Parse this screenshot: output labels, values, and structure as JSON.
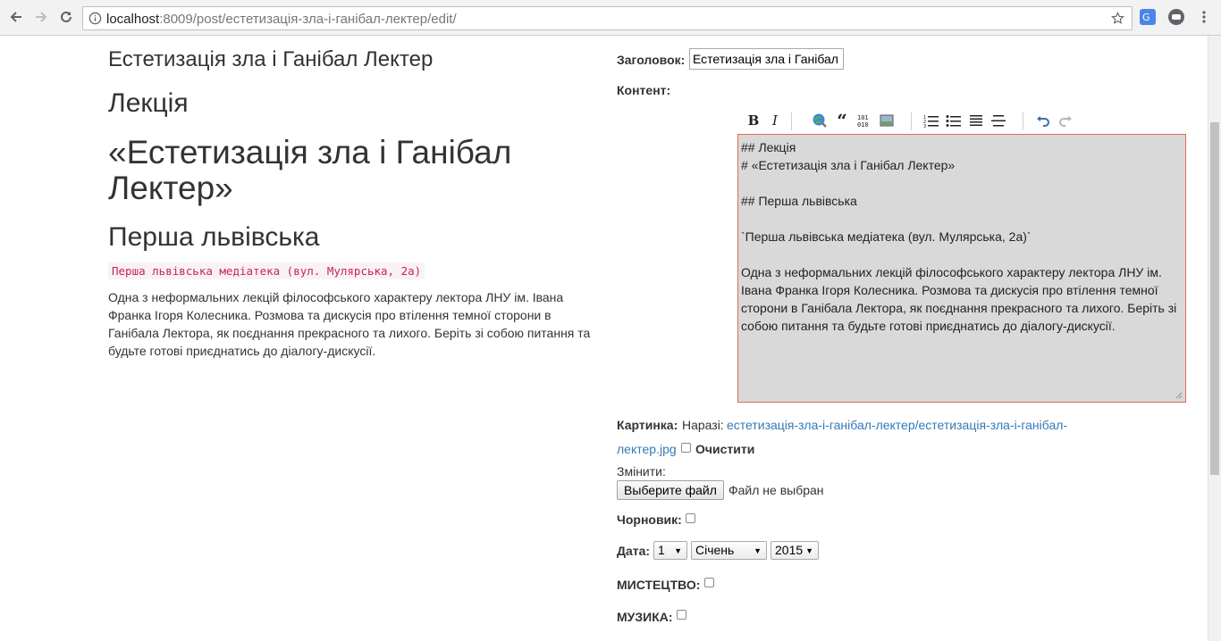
{
  "browser": {
    "url_host": "localhost",
    "url_rest": ":8009/post/естетизація-зла-і-ганібал-лектер/edit/"
  },
  "preview": {
    "title": "Естетизація зла і Ганібал Лектер",
    "h2_first": "Лекція",
    "h1": "«Естетизація зла і Ганібал Лектер»",
    "h2_second": "Перша львівська",
    "code": "Перша львівська медіатека (вул. Мулярська, 2а)",
    "paragraph": "Одна з неформальних лекцій філософського характеру лектора ЛНУ ім. Івана Франка Ігоря Колесника. Розмова та дискусія про втілення темної сторони в Ганібала Лектора, як поєднання прекрасного та лихого. Беріть зі собою питання та будьте готові приєднатись до діалогу-дискусії."
  },
  "form": {
    "title_label": "Заголовок:",
    "title_value": "Естетизація зла і Ганібал Лектер",
    "content_label": "Контент:",
    "toolbar_icons": [
      "bold-icon",
      "italic-icon",
      "link-icon",
      "quote-icon",
      "code-icon",
      "image-icon",
      "ordered-list-icon",
      "unordered-list-icon",
      "heading-icon",
      "horizontal-rule-icon",
      "undo-icon",
      "redo-icon"
    ],
    "editor_text": "## Лекція\n# «Естетизація зла і Ганібал Лектер»\n\n## Перша львівська\n\n`Перша львівська медіатека (вул. Мулярська, 2а)`\n\nОдна з неформальних лекцій філософського характеру лектора ЛНУ ім. Івана Франка Ігоря Колесника. Розмова та дискусія про втілення темної сторони в Ганібала Лектора, як поєднання прекрасного та лихого. Беріть зі собою питання та будьте готові приєднатись до діалогу-дискусії.",
    "image_label": "Картинка:",
    "image_current_prefix": "Наразі:",
    "image_link_line1": "естетизація-зла-і-ганібал-лектер/естетизація-зла-і-ганібал-",
    "image_link_line2": "лектер.jpg",
    "clear_label": "Очистити",
    "change_label": "Змінити:",
    "file_button": "Выберите файл",
    "file_status": "Файл не выбран",
    "draft_label": "Чорновик:",
    "date_label": "Дата:",
    "date_day": "1",
    "date_month": "Січень",
    "date_year": "2015",
    "category_art": "МИСТЕЦТВО:",
    "category_music": "МУЗИКА:"
  }
}
